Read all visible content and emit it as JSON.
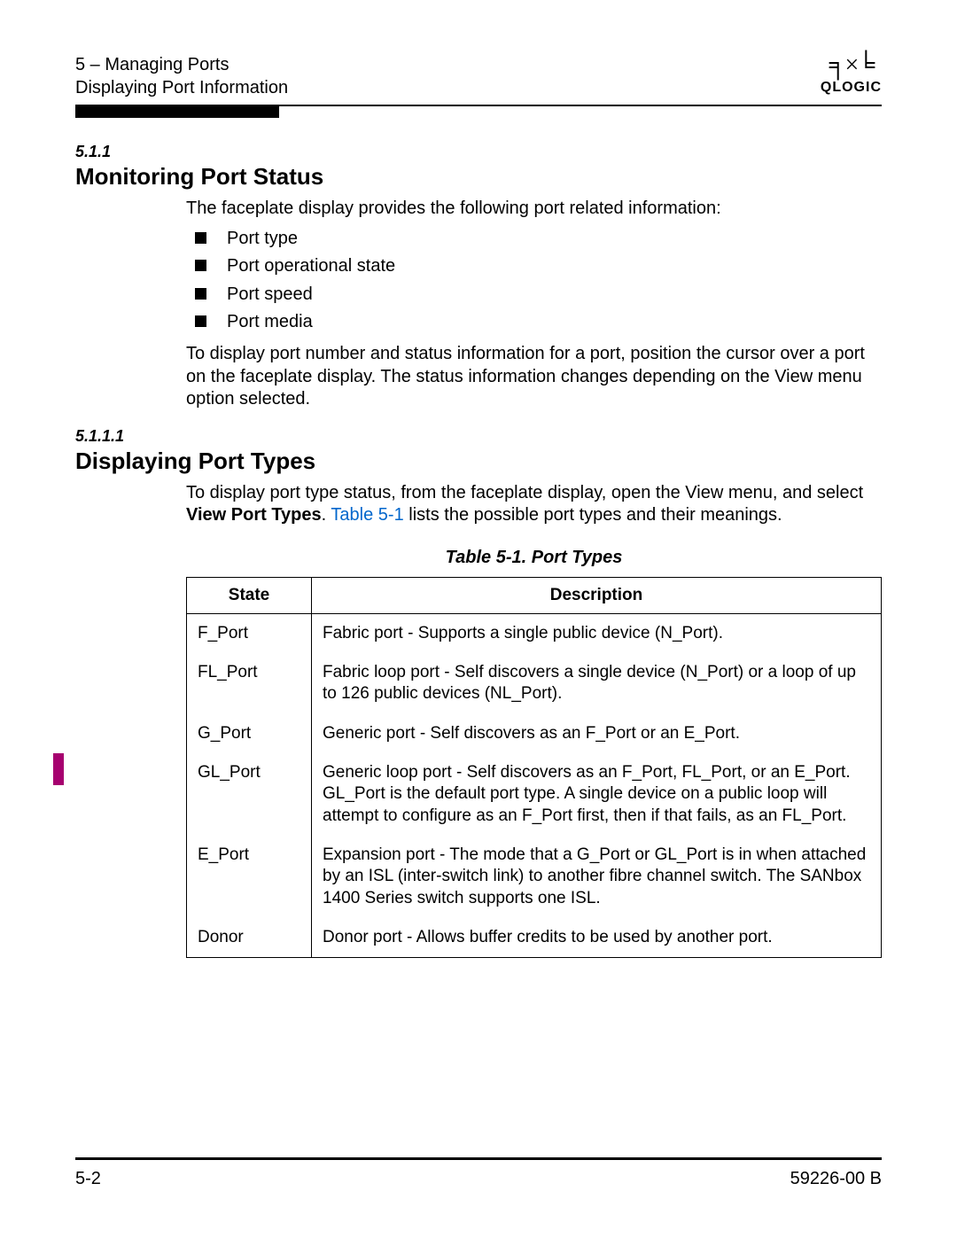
{
  "header": {
    "chapter_line": "5 – Managing Ports",
    "section_line": "Displaying Port Information",
    "logo_name": "QLOGIC"
  },
  "s511": {
    "num": "5.1.1",
    "title": "Monitoring Port Status",
    "intro": "The faceplate display provides the following port related information:",
    "bullets": [
      "Port type",
      "Port operational state",
      "Port speed",
      "Port media"
    ],
    "para2": "To display port number and status information for a port, position the cursor over a port on the faceplate display. The status information changes depending on the View menu option selected."
  },
  "s5111": {
    "num": "5.1.1.1",
    "title": "Displaying Port Types",
    "para_pre": "To display port type status, from the faceplate display, open the View menu, and select ",
    "bold": "View Port Types",
    "dot": ". ",
    "link": "Table 5-1",
    "para_post": " lists the possible port types and their meanings."
  },
  "table": {
    "caption": "Table 5-1. Port Types",
    "headers": {
      "state": "State",
      "desc": "Description"
    },
    "rows": [
      {
        "state": "F_Port",
        "desc": "Fabric port - Supports a single public device (N_Port)."
      },
      {
        "state": "FL_Port",
        "desc": "Fabric loop port - Self discovers a single device (N_Port) or a loop of up to 126 public devices (NL_Port)."
      },
      {
        "state": "G_Port",
        "desc": "Generic port - Self discovers as an F_Port or an E_Port."
      },
      {
        "state": "GL_Port",
        "desc": "Generic loop port - Self discovers as an F_Port, FL_Port, or an E_Port. GL_Port is the default port type. A single device on a public loop will attempt to configure as an F_Port first, then if that fails, as an FL_Port."
      },
      {
        "state": "E_Port",
        "desc": "Expansion port - The mode that a G_Port or GL_Port is in when attached by an ISL (inter-switch link) to another fibre channel switch. The SANbox 1400 Series switch supports one ISL."
      },
      {
        "state": "Donor",
        "desc": "Donor port - Allows buffer credits to be used by another port."
      }
    ]
  },
  "footer": {
    "page": "5-2",
    "docnum": "59226-00 B"
  }
}
